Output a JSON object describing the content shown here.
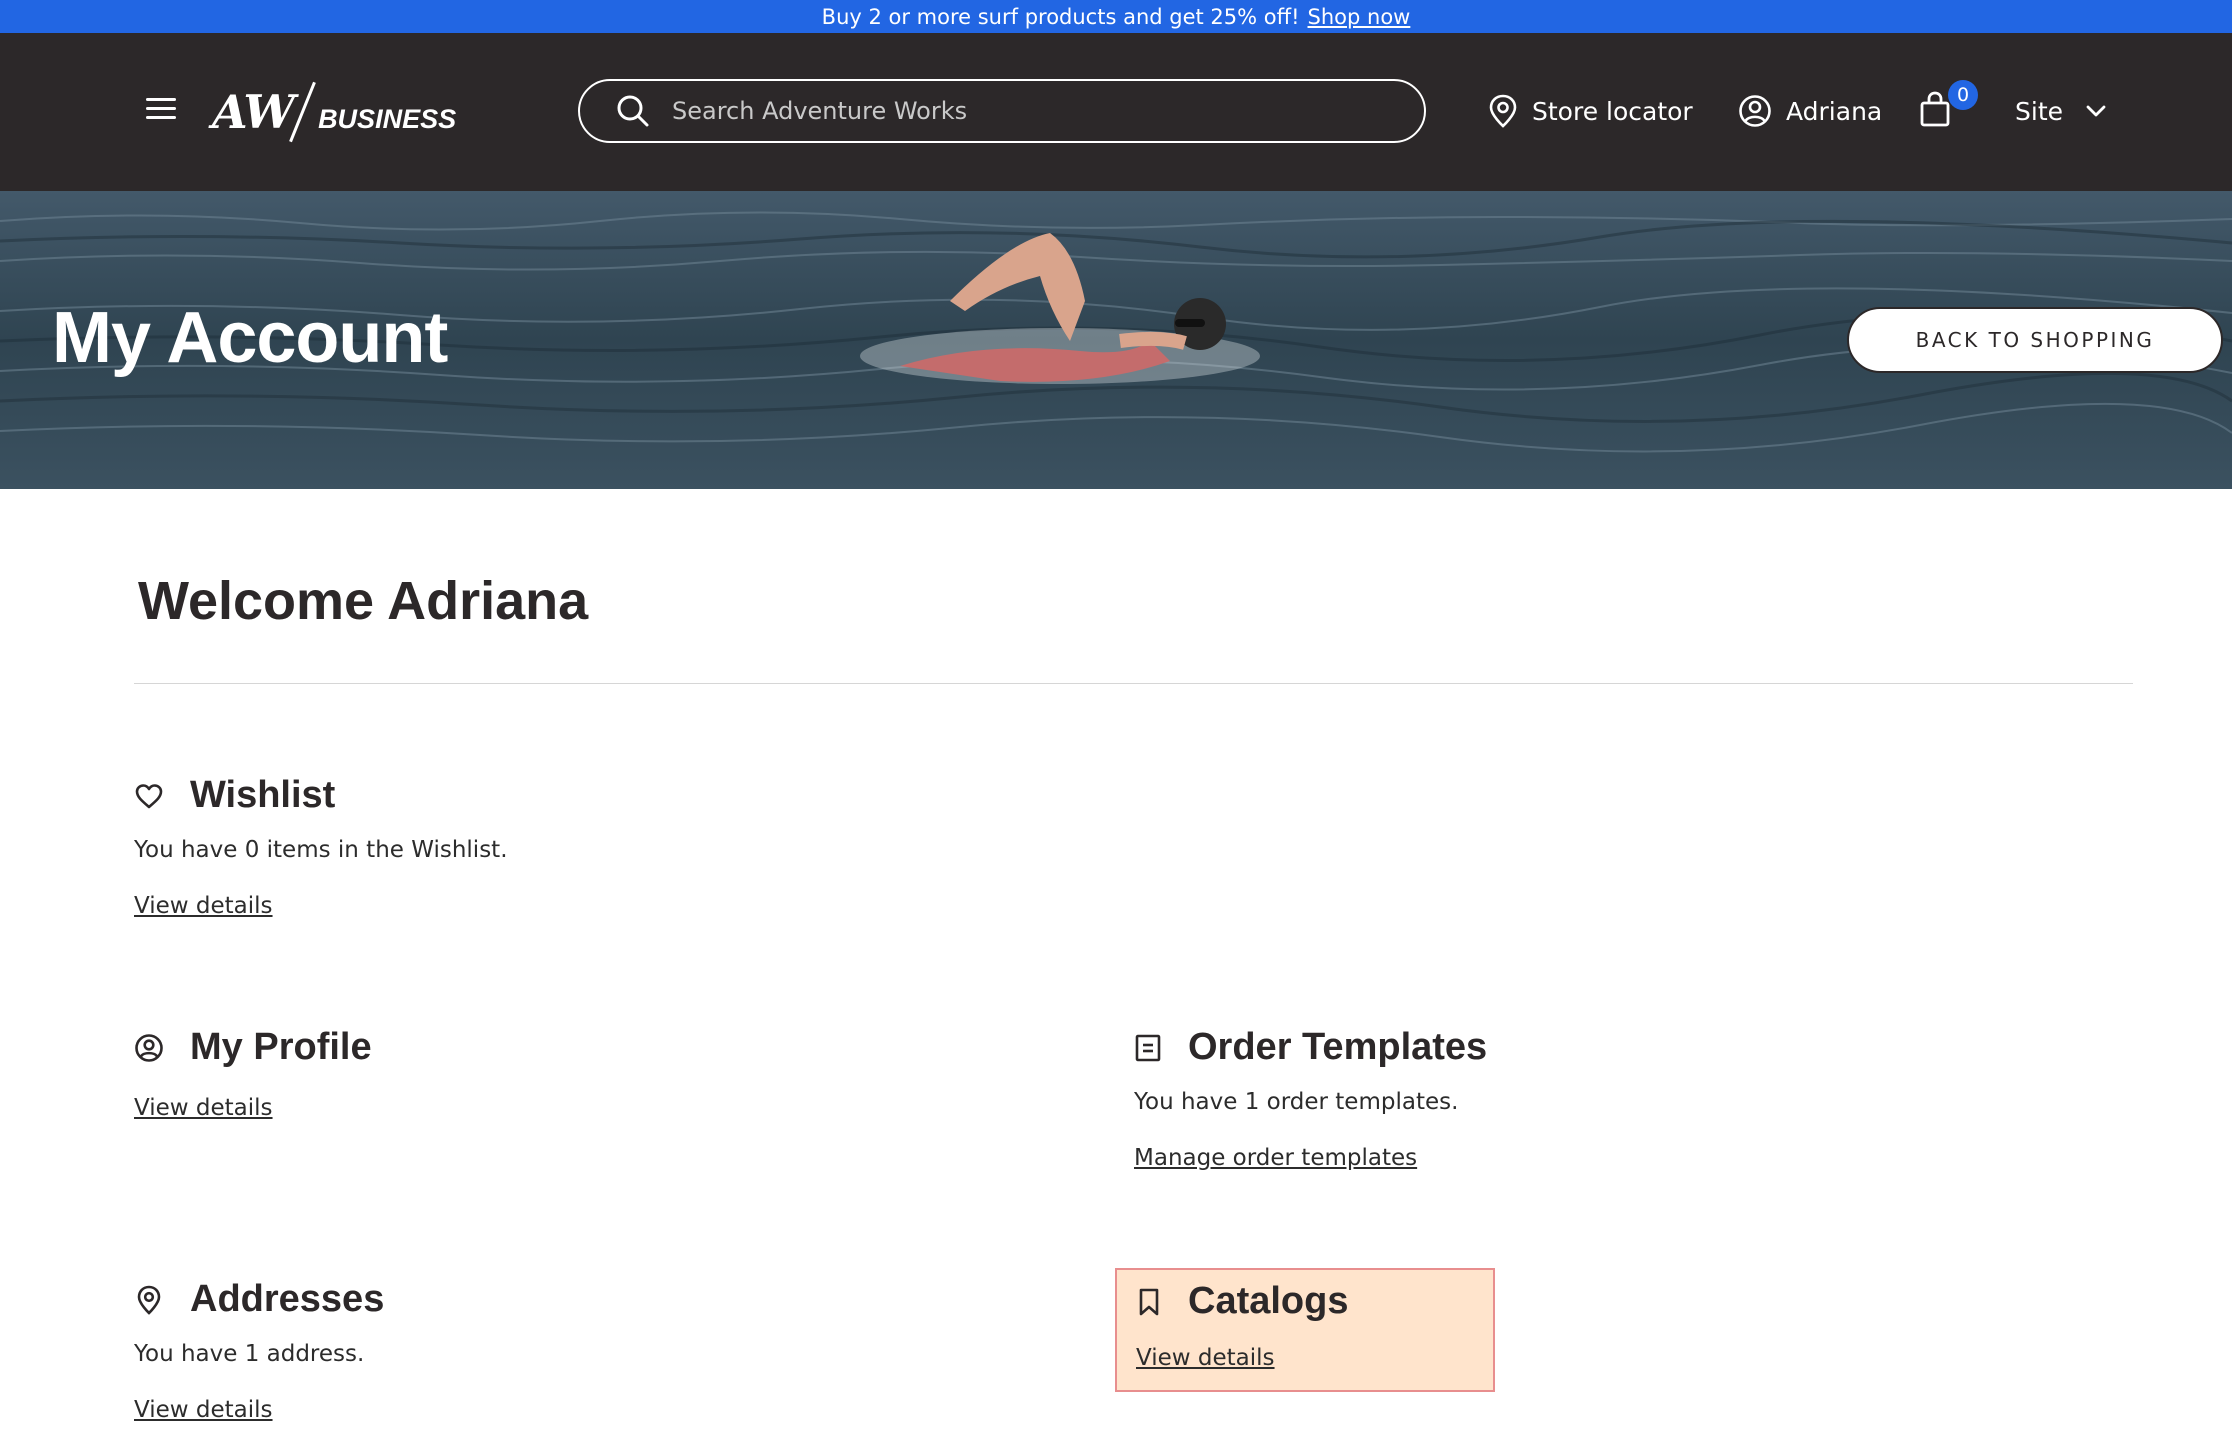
{
  "promo": {
    "text": "Buy 2 or more surf products and get 25% off!",
    "link": "Shop now"
  },
  "header": {
    "logo_primary": "AW",
    "logo_secondary": "BUSINESS",
    "search_placeholder": "Search Adventure Works",
    "store_locator": "Store locator",
    "user_name": "Adriana",
    "cart_count": "0",
    "site_label": "Site"
  },
  "hero": {
    "title": "My Account",
    "back_button": "BACK TO SHOPPING"
  },
  "main": {
    "welcome": "Welcome Adriana",
    "wishlist": {
      "title": "Wishlist",
      "text": "You have 0 items in the Wishlist.",
      "link": "View details",
      "icon": "heart-icon"
    },
    "profile": {
      "title": "My Profile",
      "link": "View details",
      "icon": "user-circle-icon"
    },
    "templates": {
      "title": "Order Templates",
      "text": "You have 1 order templates.",
      "link": "Manage order templates",
      "icon": "document-icon"
    },
    "addresses": {
      "title": "Addresses",
      "text": "You have 1 address.",
      "link": "View details",
      "icon": "location-pin-icon"
    },
    "catalogs": {
      "title": "Catalogs",
      "link": "View details",
      "icon": "bookmark-icon"
    }
  },
  "colors": {
    "promo_bg": "#2266e3",
    "header_bg": "#2c2829",
    "highlight_bg": "#ffe4cc",
    "highlight_border": "#e88e8e"
  }
}
